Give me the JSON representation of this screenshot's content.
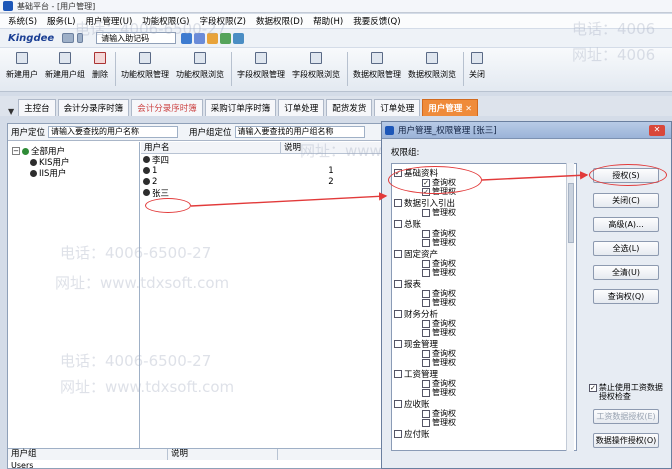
{
  "window_title": "基础平台 - [用户管理]",
  "menu": [
    "系统(S)",
    "服务(L)",
    "用户管理(U)",
    "功能权限(G)",
    "字段权限(Z)",
    "数据权限(D)",
    "帮助(H)",
    "我要反馈(Q)"
  ],
  "kingdee": {
    "logo": "Kingdee",
    "input": "请输入助记码"
  },
  "toolbar": [
    "新建用户",
    "新建用户组",
    "删除",
    "功能权限管理",
    "功能权限浏览",
    "字段权限管理",
    "字段权限浏览",
    "数据权限管理",
    "数据权限浏览",
    "关闭"
  ],
  "tabs": [
    "主控台",
    "会计分录序时簿",
    "会计分录序时簿",
    "采购订单序时簿",
    "订单处理",
    "配货发货",
    "订单处理",
    "用户管理"
  ],
  "search": {
    "user_label": "用户定位",
    "user_placeholder": "请输入要查找的用户名称",
    "group_label": "用户组定位",
    "group_placeholder": "请输入要查找的用户组名称"
  },
  "tree": {
    "root": "全部用户",
    "children": [
      "KIS用户",
      "IIS用户"
    ]
  },
  "user_list": {
    "headers": [
      "用户名",
      "说明"
    ],
    "rows": [
      {
        "name": "李四",
        "desc": ""
      },
      {
        "name": "1",
        "desc": "1"
      },
      {
        "name": "2",
        "desc": "2"
      },
      {
        "name": "张三",
        "desc": ""
      }
    ]
  },
  "group_list": {
    "headers": [
      "用户组",
      "说明"
    ],
    "first_row": "Users"
  },
  "dialog": {
    "title": "用户管理_权限管理 [张三]",
    "perm_label": "权限组:",
    "groups": [
      {
        "name": "基础资料",
        "checked": true,
        "children": [
          {
            "name": "查询权",
            "checked": true
          },
          {
            "name": "管理权",
            "checked": true
          }
        ]
      },
      {
        "name": "数据引入引出",
        "checked": false,
        "children": [
          {
            "name": "管理权",
            "checked": false
          }
        ]
      },
      {
        "name": "总账",
        "checked": false,
        "children": [
          {
            "name": "查询权",
            "checked": false
          },
          {
            "name": "管理权",
            "checked": false
          }
        ]
      },
      {
        "name": "固定资产",
        "checked": false,
        "children": [
          {
            "name": "查询权",
            "checked": false
          },
          {
            "name": "管理权",
            "checked": false
          }
        ]
      },
      {
        "name": "报表",
        "checked": false,
        "children": [
          {
            "name": "查询权",
            "checked": false
          },
          {
            "name": "管理权",
            "checked": false
          }
        ]
      },
      {
        "name": "财务分析",
        "checked": false,
        "children": [
          {
            "name": "查询权",
            "checked": false
          },
          {
            "name": "管理权",
            "checked": false
          }
        ]
      },
      {
        "name": "现金管理",
        "checked": false,
        "children": [
          {
            "name": "查询权",
            "checked": false
          },
          {
            "name": "管理权",
            "checked": false
          }
        ]
      },
      {
        "name": "工资管理",
        "checked": false,
        "children": [
          {
            "name": "查询权",
            "checked": false
          },
          {
            "name": "管理权",
            "checked": false
          }
        ]
      },
      {
        "name": "应收账",
        "checked": false,
        "children": [
          {
            "name": "查询权",
            "checked": false
          },
          {
            "name": "管理权",
            "checked": false
          }
        ]
      },
      {
        "name": "应付账",
        "checked": false,
        "children": []
      }
    ],
    "buttons": {
      "grant": "授权(S)",
      "close": "关闭(C)",
      "advanced": "高级(A)...",
      "select_all": "全选(L)",
      "clear_all": "全清(U)",
      "query": "查询权(Q)",
      "salary": "工资数据授权(E)",
      "data_ops": "数据操作授权(O)"
    },
    "forbid_label": "禁止使用工资数据授权检查",
    "forbid_checked": true
  },
  "watermarks": [
    "电话：4006-6500-27",
    "网址：www.tdxsoft.com",
    "电话：4006",
    "网址：4006",
    "电话：4006-6500-27",
    "网址：www.tdxsoft.com",
    "电话：4006-6500-27",
    "网址：www.tdxsoft.com"
  ],
  "colors": {
    "accent": "#ef8b3a",
    "annotation": "#e23a3a",
    "panel_green": "#ffffff"
  }
}
